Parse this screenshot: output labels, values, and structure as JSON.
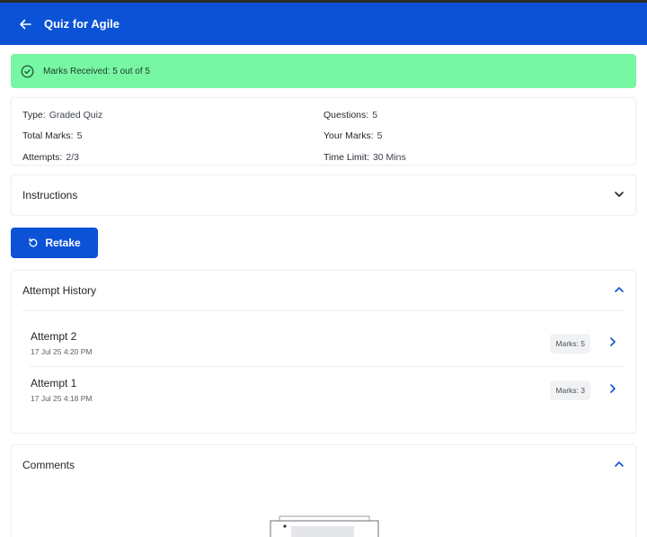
{
  "header": {
    "title": "Quiz for Agile",
    "back_icon": "arrow-left-icon"
  },
  "banner": {
    "text": "Marks Received: 5 out of 5",
    "icon": "check-circle-icon",
    "bg": "#77f7a3"
  },
  "info": {
    "type_label": "Type:",
    "type_value": "Graded Quiz",
    "total_label": "Total Marks:",
    "total_value": "5",
    "attempts_label": "Attempts:",
    "attempts_value": "2/3",
    "questions_label": "Questions:",
    "questions_value": "5",
    "your_label": "Your Marks:",
    "your_value": "5",
    "time_label": "Time Limit:",
    "time_value": "30 Mins"
  },
  "instructions": {
    "label": "Instructions"
  },
  "retake": {
    "label": "Retake"
  },
  "history": {
    "label": "Attempt History",
    "attempts": [
      {
        "name": "Attempt 2",
        "time": "17 Jul 25 4:20 PM",
        "marks": "Marks: 5"
      },
      {
        "name": "Attempt 1",
        "time": "17 Jul 25 4:18 PM",
        "marks": "Marks: 3"
      }
    ]
  },
  "comments": {
    "label": "Comments"
  },
  "colors": {
    "primary": "#0b52d6",
    "success_bg": "#77f7a3"
  }
}
